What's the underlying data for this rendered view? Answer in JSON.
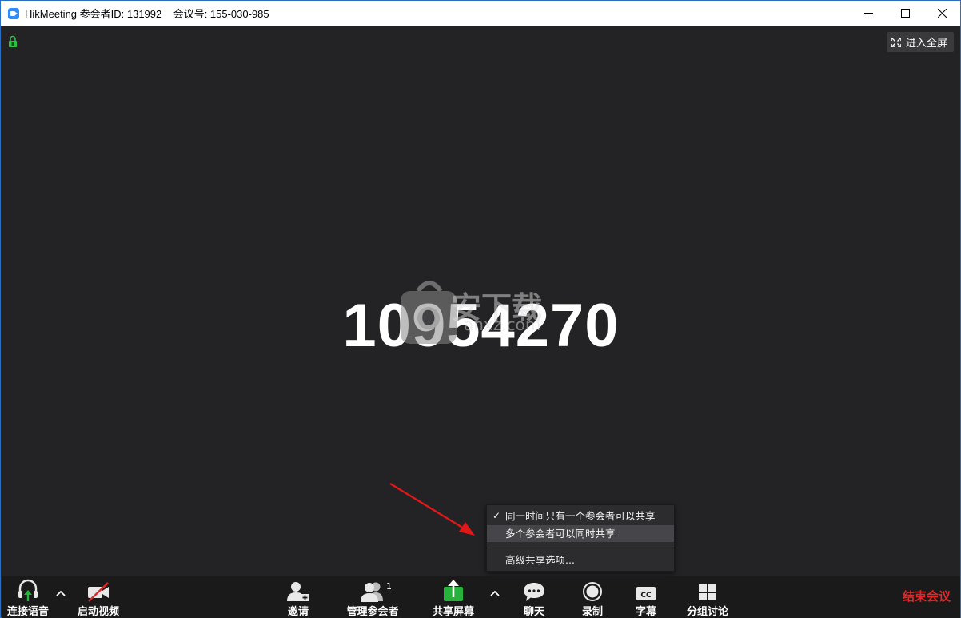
{
  "window": {
    "title": "HikMeeting 参会者ID: 131992    会议号: 155-030-985"
  },
  "stage": {
    "fullscreen_label": "进入全屏",
    "big_number": "10954270",
    "watermark_text": "安下载",
    "watermark_sub": "anxz.com"
  },
  "share_menu": {
    "items": [
      {
        "label": "同一时间只有一个参会者可以共享",
        "checked": true
      },
      {
        "label": "多个参会者可以同时共享",
        "checked": false
      },
      {
        "label": "高级共享选项..."
      }
    ],
    "check_mark": "✓"
  },
  "toolbar": {
    "audio_label": "连接语音",
    "video_label": "启动视频",
    "invite_label": "邀请",
    "participants_label": "管理参会者",
    "participants_count": "1",
    "share_label": "共享屏幕",
    "chat_label": "聊天",
    "record_label": "录制",
    "caption_label": "字幕",
    "caption_icon_text": "CC",
    "breakout_label": "分组讨论",
    "end_label": "结束会议"
  },
  "colors": {
    "accent_blue": "#2d8cff",
    "share_green": "#25b33b",
    "end_red": "#e02828",
    "stage_bg": "#232225"
  }
}
